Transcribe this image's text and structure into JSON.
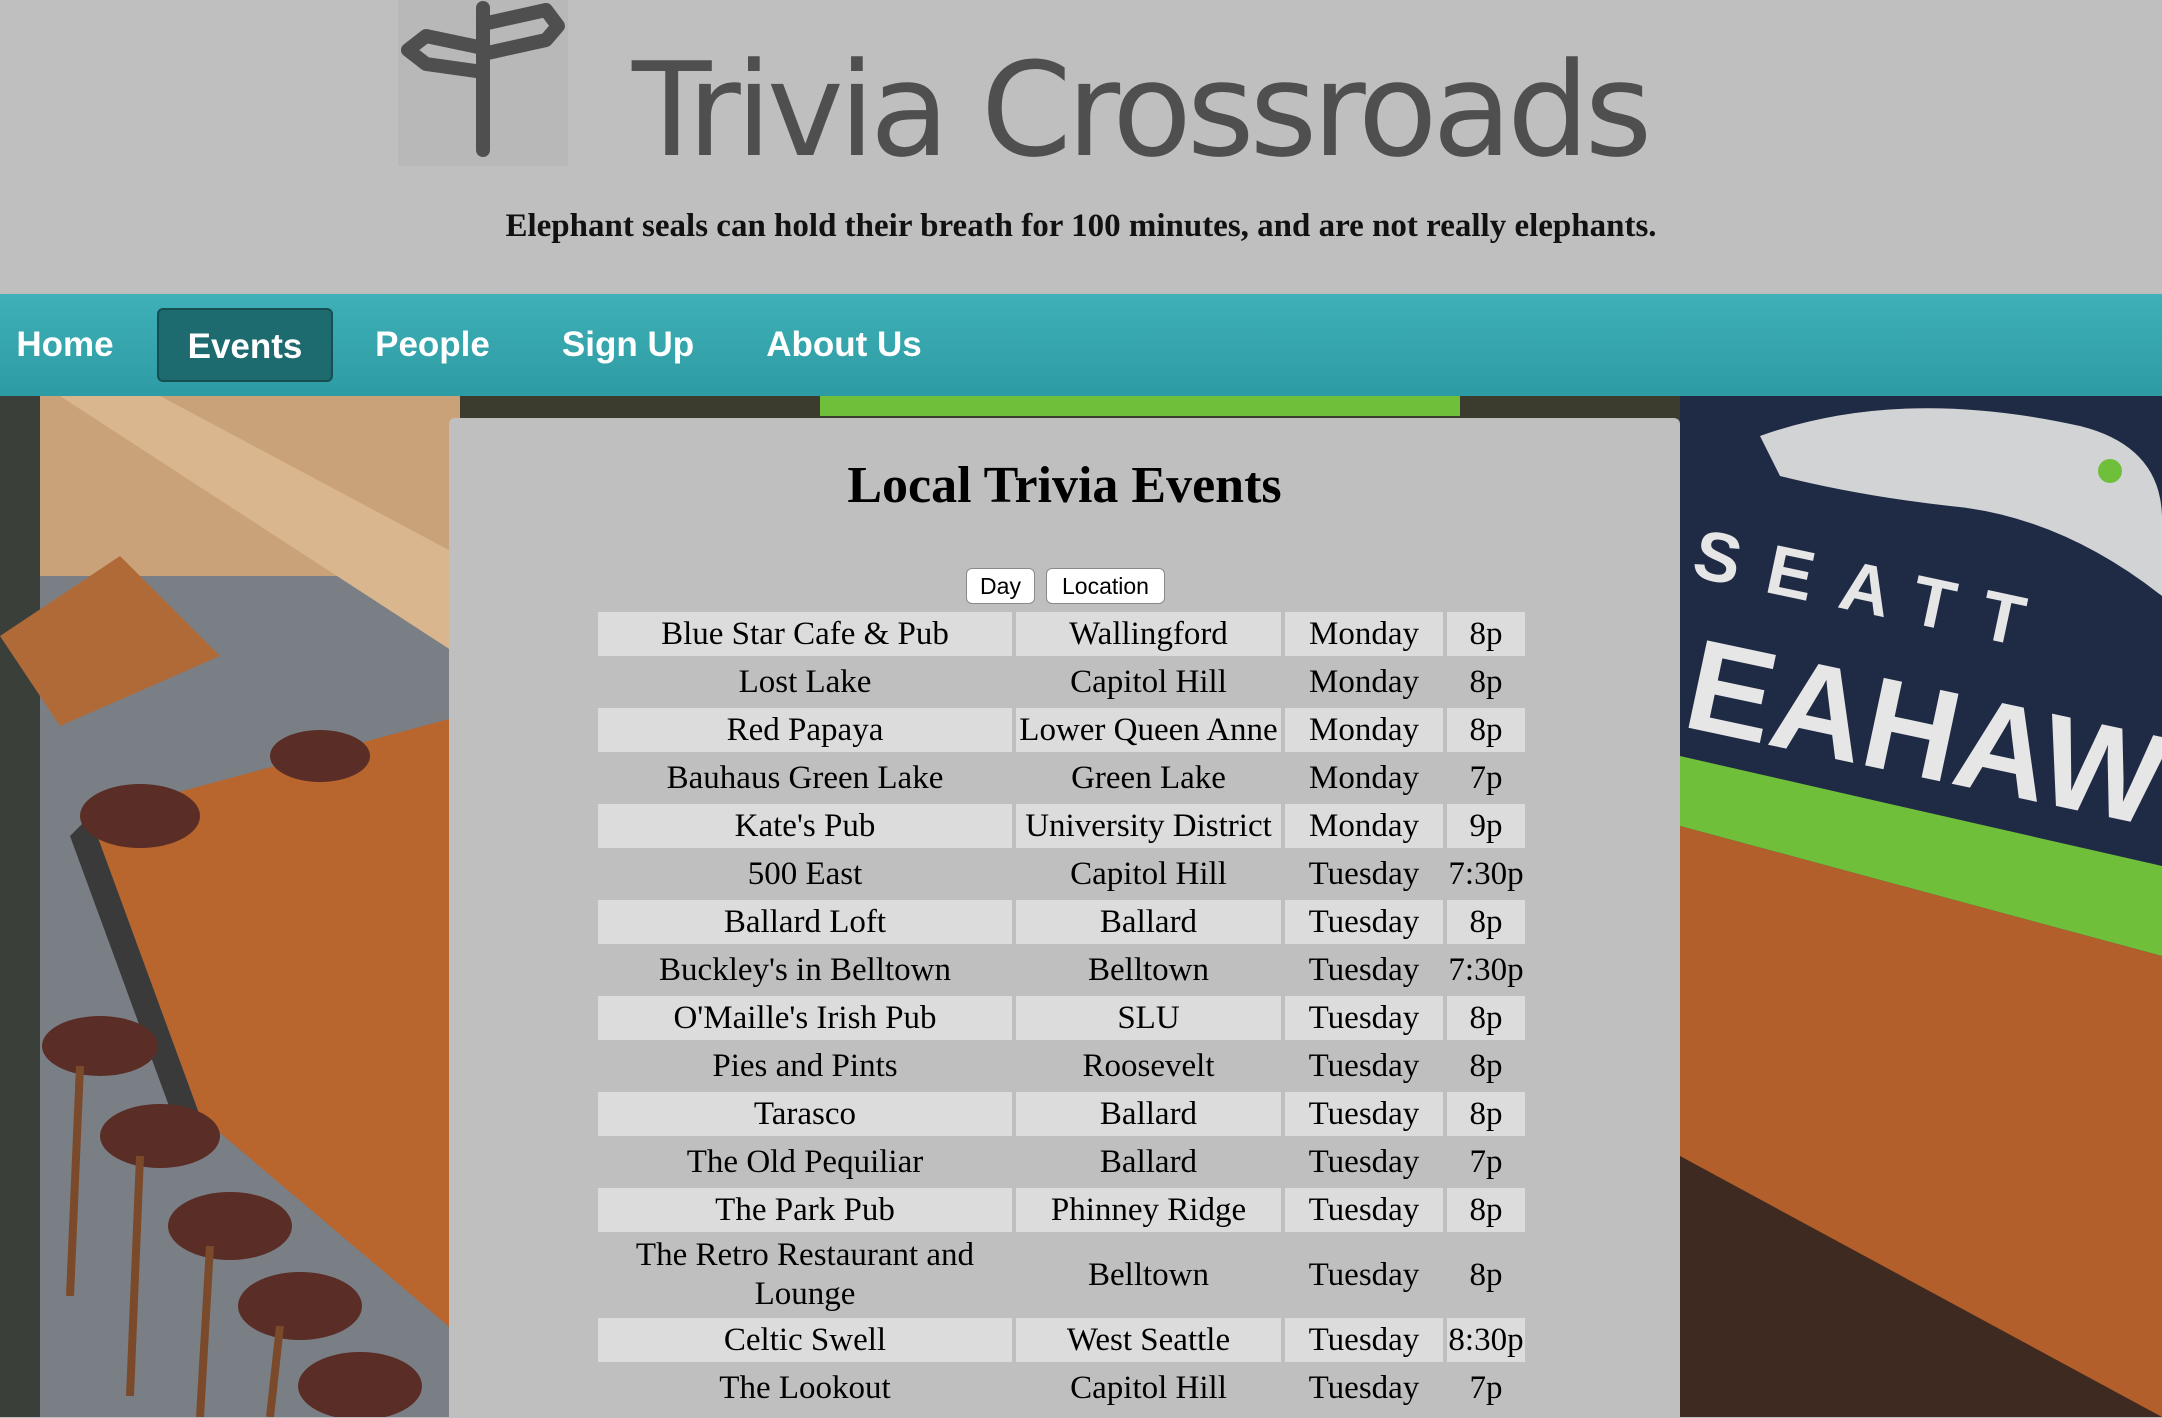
{
  "site": {
    "title": "Trivia Crossroads",
    "fact": "Elephant seals can hold their breath for 100 minutes, and are not really elephants.",
    "logo_icon": "signpost-icon"
  },
  "nav": {
    "items": [
      {
        "label": "Home",
        "active": false
      },
      {
        "label": "Events",
        "active": true
      },
      {
        "label": "People",
        "active": false
      },
      {
        "label": "Sign Up",
        "active": false
      },
      {
        "label": "About Us",
        "active": false
      }
    ]
  },
  "panel": {
    "title": "Local Trivia Events",
    "sort_buttons": [
      "Day",
      "Location"
    ]
  },
  "events": [
    [
      "Blue Star Cafe & Pub",
      "Wallingford",
      "Monday",
      "8p"
    ],
    [
      "Lost Lake",
      "Capitol Hill",
      "Monday",
      "8p"
    ],
    [
      "Red Papaya",
      "Lower Queen Anne",
      "Monday",
      "8p"
    ],
    [
      "Bauhaus Green Lake",
      "Green Lake",
      "Monday",
      "7p"
    ],
    [
      "Kate's Pub",
      "University District",
      "Monday",
      "9p"
    ],
    [
      "500 East",
      "Capitol Hill",
      "Tuesday",
      "7:30p"
    ],
    [
      "Ballard Loft",
      "Ballard",
      "Tuesday",
      "8p"
    ],
    [
      "Buckley's in Belltown",
      "Belltown",
      "Tuesday",
      "7:30p"
    ],
    [
      "O'Maille's Irish Pub",
      "SLU",
      "Tuesday",
      "8p"
    ],
    [
      "Pies and Pints",
      "Roosevelt",
      "Tuesday",
      "8p"
    ],
    [
      "Tarasco",
      "Ballard",
      "Tuesday",
      "8p"
    ],
    [
      "The Old Pequiliar",
      "Ballard",
      "Tuesday",
      "7p"
    ],
    [
      "The Park Pub",
      "Phinney Ridge",
      "Tuesday",
      "8p"
    ],
    [
      "The Retro Restaurant and Lounge",
      "Belltown",
      "Tuesday",
      "8p"
    ],
    [
      "Celtic Swell",
      "West Seattle",
      "Tuesday",
      "8:30p"
    ],
    [
      "The Lookout",
      "Capitol Hill",
      "Tuesday",
      "7p"
    ]
  ],
  "background": {
    "banner_text": [
      "SEATT",
      "EAHAW"
    ],
    "colors": {
      "nav_teal": "#35a7ae",
      "nav_active": "#1d6b6f",
      "banner_navy": "#1f2a44",
      "banner_green": "#6fbf3a",
      "wood": "#b35f2b"
    }
  }
}
